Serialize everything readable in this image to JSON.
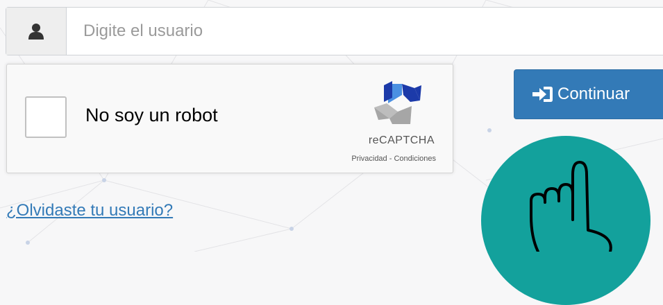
{
  "login": {
    "username_placeholder": "Digite el usuario",
    "username_value": ""
  },
  "captcha": {
    "label": "No soy un robot",
    "brand": "reCAPTCHA",
    "privacy": "Privacidad",
    "separator": " - ",
    "terms": "Condiciones",
    "checked": false
  },
  "actions": {
    "continue_label": "Continuar",
    "forgot_label": "¿Olvidaste tu usuario?"
  },
  "colors": {
    "primary": "#337ab7",
    "accent_circle": "#13a19c",
    "background": "#f7f7f8"
  },
  "icons": {
    "user": "user-icon",
    "sign_in": "sign-in-icon",
    "recaptcha": "recaptcha-logo-icon",
    "pointer": "pointing-hand-icon"
  }
}
